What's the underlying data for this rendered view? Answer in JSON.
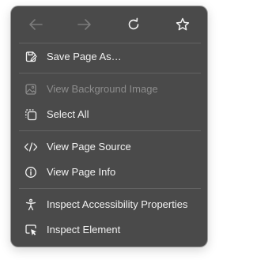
{
  "toolbar": {
    "back_icon": "arrow-left-icon",
    "forward_icon": "arrow-right-icon",
    "reload_icon": "reload-icon",
    "bookmark_icon": "star-icon"
  },
  "menu": {
    "items": [
      {
        "label": "Save Page As…",
        "icon": "save-page-icon",
        "enabled": true
      },
      {
        "label": "View Background Image",
        "icon": "image-icon",
        "enabled": false
      },
      {
        "label": "Select All",
        "icon": "select-all-icon",
        "enabled": true
      },
      {
        "label": "View Page Source",
        "icon": "code-icon",
        "enabled": true
      },
      {
        "label": "View Page Info",
        "icon": "info-icon",
        "enabled": true
      },
      {
        "label": "Inspect Accessibility Properties",
        "icon": "accessibility-icon",
        "enabled": true
      },
      {
        "label": "Inspect Element",
        "icon": "inspect-element-icon",
        "enabled": true
      }
    ]
  },
  "colors": {
    "menu_background": "#4a4a4a",
    "text": "#f2f2f2",
    "disabled_text": "#8d8d8d",
    "separator": "#636363"
  }
}
